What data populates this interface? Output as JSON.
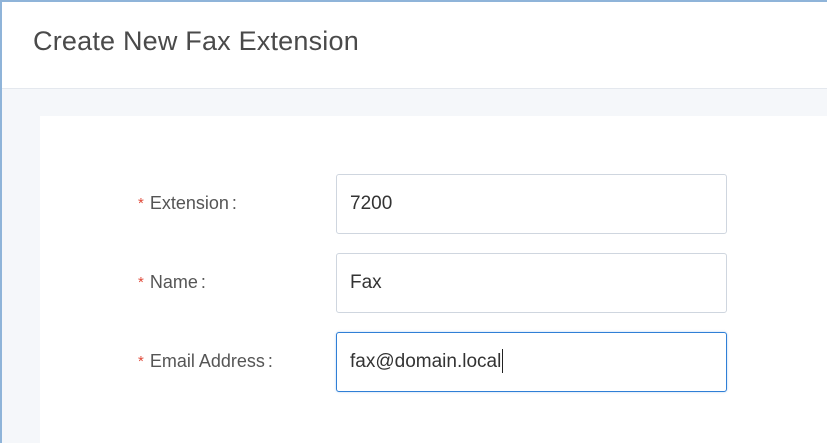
{
  "page": {
    "title": "Create New Fax Extension"
  },
  "form": {
    "fields": [
      {
        "label": "Extension",
        "value": "7200",
        "required": true
      },
      {
        "label": "Name",
        "value": "Fax",
        "required": true
      },
      {
        "label": "Email Address",
        "value": "fax@domain.local",
        "required": true
      }
    ],
    "required_marker": "*",
    "label_suffix": ":"
  },
  "colors": {
    "required_star": "#e04a3a",
    "focus_border": "#2f7fd6",
    "frame_border": "#8fb4d9"
  }
}
